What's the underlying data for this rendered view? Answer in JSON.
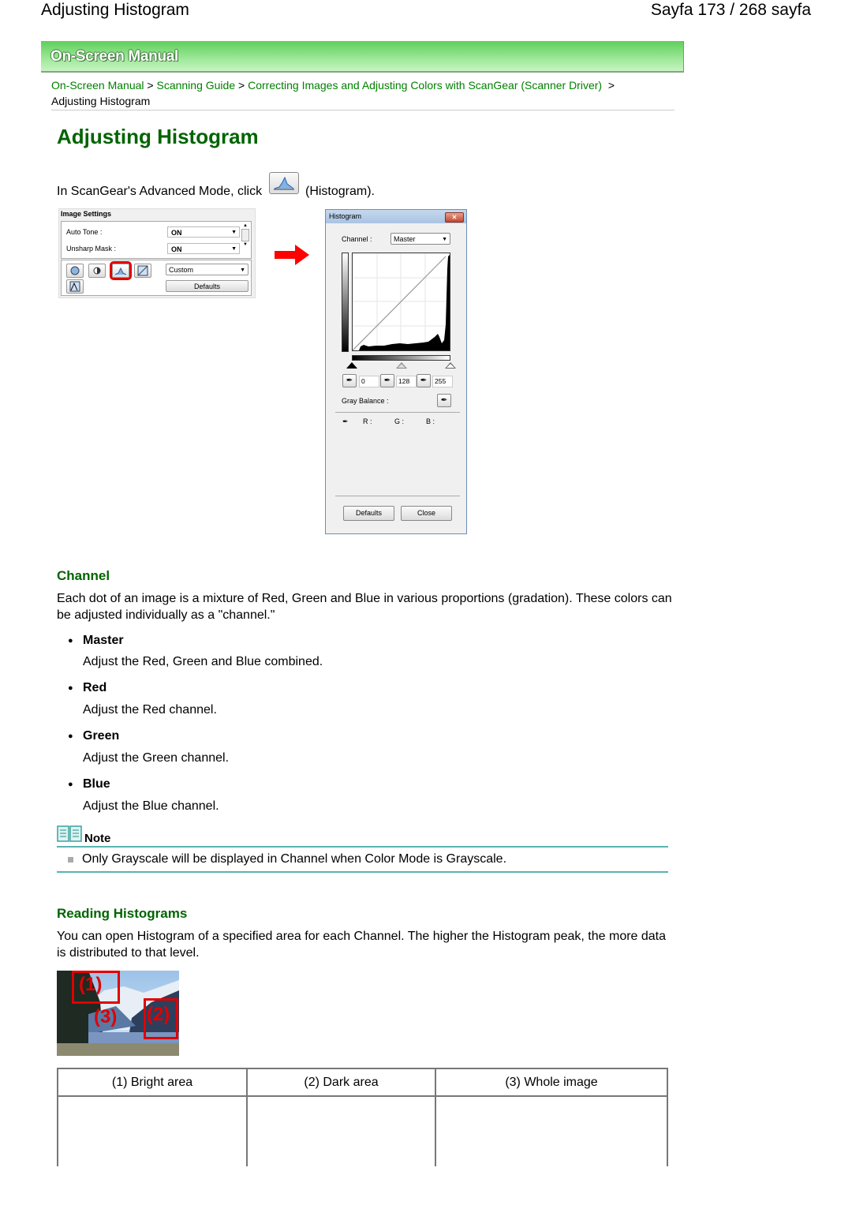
{
  "page_header": {
    "title": "Adjusting Histogram",
    "page_indicator": "Sayfa 173 / 268 sayfa"
  },
  "banner": {
    "title": "On-Screen Manual"
  },
  "breadcrumb": {
    "items": [
      "On-Screen Manual",
      "Scanning Guide",
      "Correcting Images and Adjusting Colors with ScanGear (Scanner Driver)"
    ],
    "separator": ">",
    "current": "Adjusting Histogram"
  },
  "main": {
    "title": "Adjusting Histogram",
    "intro_before": "In ScanGear's Advanced Mode, click",
    "intro_after": "(Histogram).",
    "image_settings": {
      "title": "Image Settings",
      "rows": [
        {
          "label": "Auto Tone :",
          "value": "ON"
        },
        {
          "label": "Unsharp Mask :",
          "value": "ON"
        }
      ],
      "preset": "Custom",
      "defaults_label": "Defaults"
    },
    "histogram_dialog": {
      "title": "Histogram",
      "close_glyph": "✕",
      "channel_label": "Channel :",
      "channel_value": "Master",
      "black_point": "0",
      "mid_point": "128",
      "white_point": "255",
      "gray_balance_label": "Gray Balance :",
      "r_label": "R :",
      "g_label": "G :",
      "b_label": "B :",
      "defaults_label": "Defaults",
      "close_label": "Close"
    },
    "channel": {
      "heading": "Channel",
      "description": "Each dot of an image is a mixture of Red, Green and Blue in various proportions (gradation). These colors can be adjusted individually as a \"channel.\"",
      "items": [
        {
          "name": "Master",
          "desc": "Adjust the Red, Green and Blue combined."
        },
        {
          "name": "Red",
          "desc": "Adjust the Red channel."
        },
        {
          "name": "Green",
          "desc": "Adjust the Green channel."
        },
        {
          "name": "Blue",
          "desc": "Adjust the Blue channel."
        }
      ]
    },
    "note": {
      "label": "Note",
      "items": [
        "Only Grayscale will be displayed in Channel when Color Mode is Grayscale."
      ]
    },
    "reading": {
      "heading": "Reading Histograms",
      "description": "You can open Histogram of a specified area for each Channel. The higher the Histogram peak, the more data is distributed to that level.",
      "photo_labels": [
        "(1)",
        "(2)",
        "(3)"
      ],
      "table_headers": [
        "(1) Bright area",
        "(2) Dark area",
        "(3) Whole image"
      ]
    }
  },
  "colors": {
    "heading_green": "#006400",
    "link_green": "#008000",
    "note_teal": "#5bb3b0",
    "highlight_red": "#e00000"
  }
}
